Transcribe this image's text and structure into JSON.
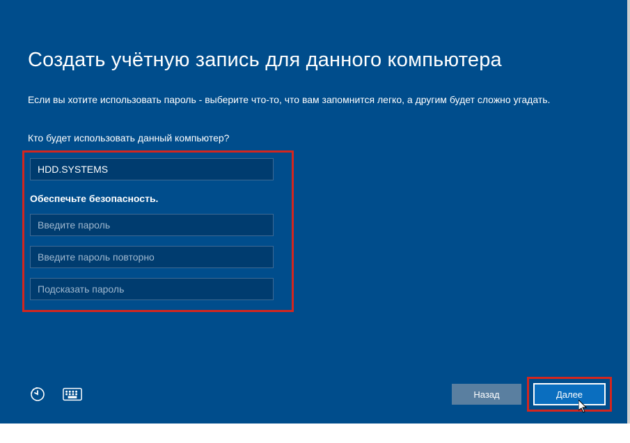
{
  "title": "Создать учётную запись для данного компьютера",
  "description": "Если вы хотите использовать пароль - выберите что-то, что вам запомнится легко, а другим будет сложно угадать.",
  "section_user_label": "Кто будет использовать данный компьютер?",
  "username_value": "HDD.SYSTEMS",
  "security_label": "Обеспечьте безопасность.",
  "password_placeholder": "Введите пароль",
  "password_confirm_placeholder": "Введите пароль повторно",
  "password_hint_placeholder": "Подсказать пароль",
  "buttons": {
    "back": "Назад",
    "next": "Далее"
  }
}
